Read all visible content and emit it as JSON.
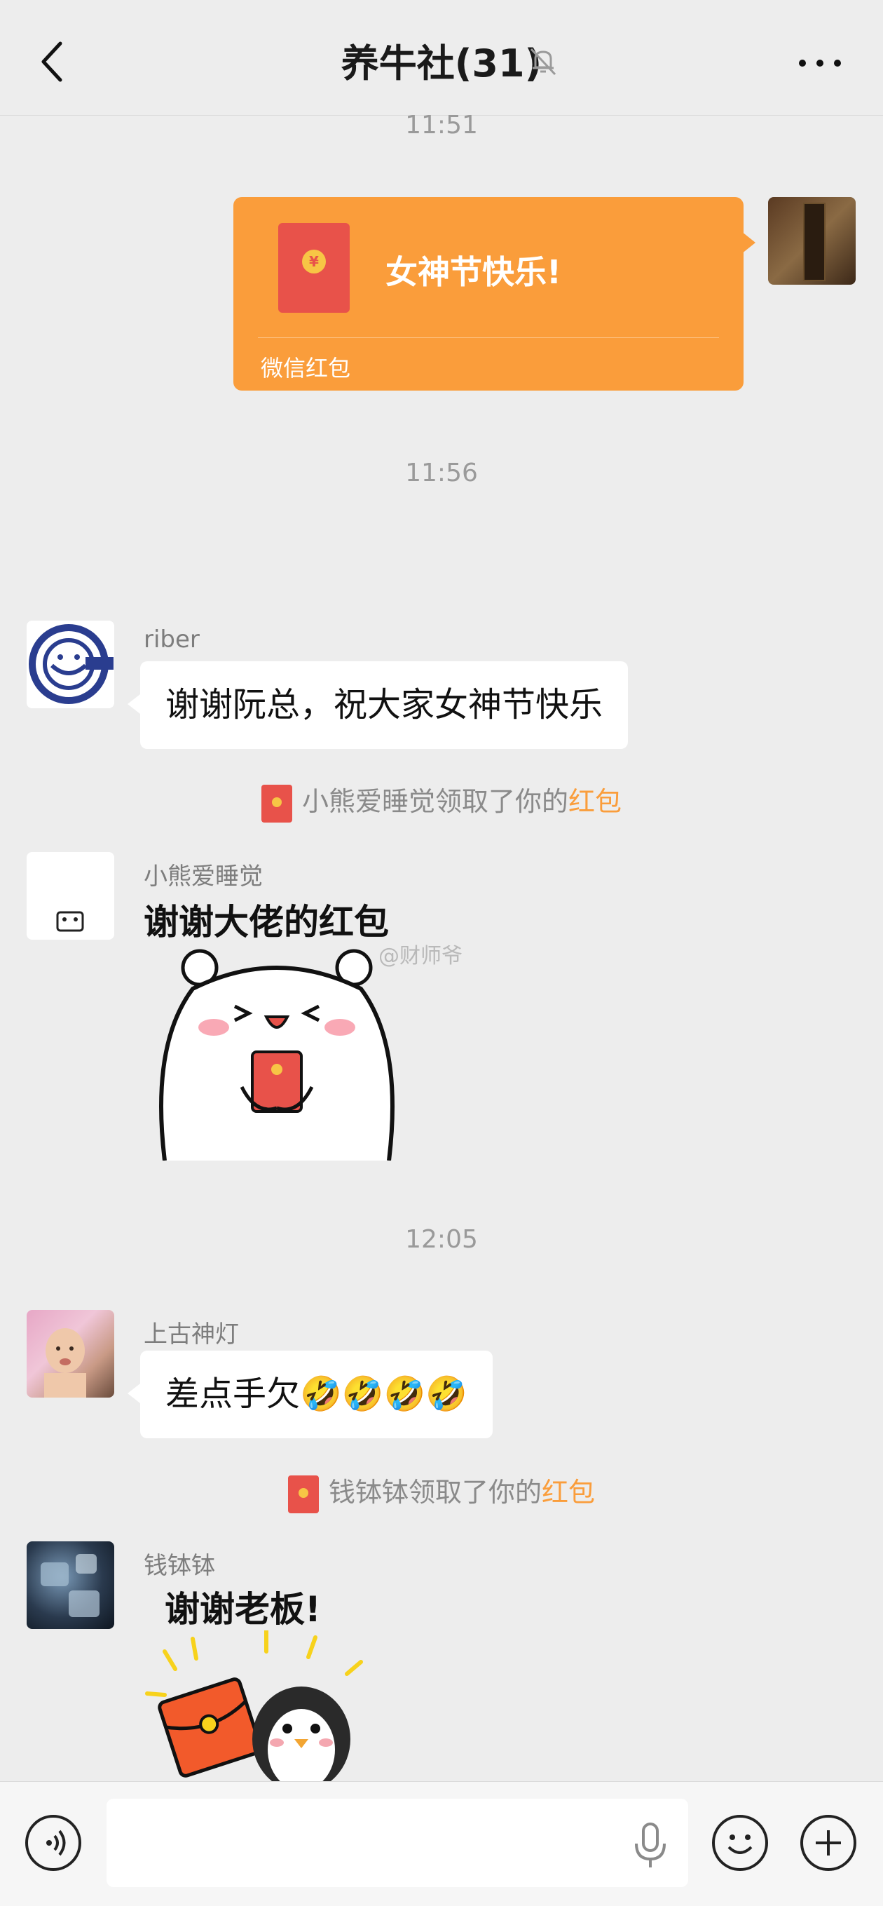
{
  "header": {
    "title": "养牛社(31)",
    "back_icon": "chevron-left-icon",
    "mute_icon": "bell-muted-icon",
    "more_icon": "more-horizontal-icon"
  },
  "messages": {
    "time1": "11:51",
    "red_packet": {
      "greeting": "女神节快乐!",
      "label": "微信红包",
      "color": "#fa9d3b"
    },
    "time2": "11:56",
    "msg_riber": {
      "name": "riber",
      "text": "谢谢阮总，祝大家女神节快乐"
    },
    "sys1": {
      "prefix": "小熊爱睡觉领取了你的",
      "link": "红包"
    },
    "msg_bear": {
      "name": "小熊爱睡觉",
      "sticker_text": "谢谢大佬的红包"
    },
    "watermark": "@财师爷",
    "time3": "12:05",
    "msg_shanggu": {
      "name": "上古神灯",
      "text": "差点手欠🤣🤣🤣🤣"
    },
    "sys2": {
      "prefix": "钱钵钵领取了你的",
      "link": "红包"
    },
    "msg_qian": {
      "name": "钱钵钵",
      "sticker_text": "谢谢老板!"
    }
  },
  "input_bar": {
    "voice_icon": "voice-icon",
    "mic_icon": "microphone-icon",
    "emoji_icon": "emoji-icon",
    "plus_icon": "plus-icon"
  },
  "colors": {
    "background": "#ededed",
    "accent_orange": "#fa9d3b",
    "red_packet_red": "#e8524a"
  }
}
